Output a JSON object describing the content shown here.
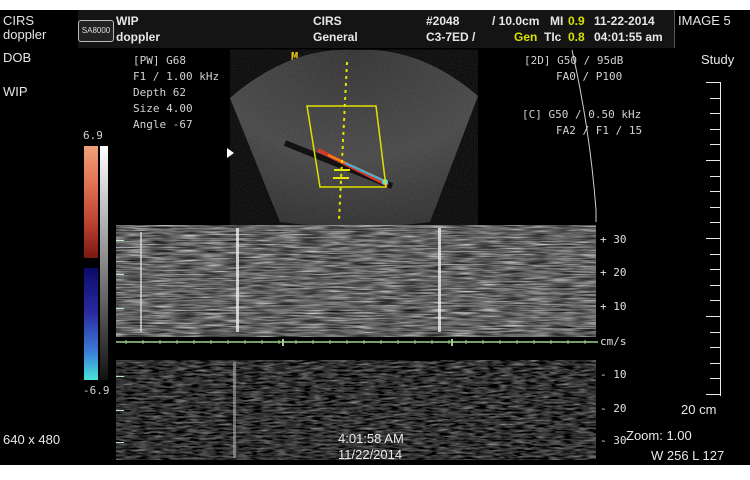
{
  "header": {
    "left_title": "CIRS",
    "left_sub": "doppler",
    "logo": "SA8000",
    "wip_title": "WIP",
    "wip_sub": "doppler",
    "center_title": "CIRS",
    "center_sub": "General",
    "probe_id": "#2048",
    "depth_cm": "/ 10.0cm",
    "mi_label": "MI",
    "mi_value": "0.9",
    "probe_model": "C3-7ED /",
    "gen_label": "Gen",
    "tic_label": "TIc",
    "tic_value": "0.8",
    "date": "11-22-2014",
    "time": "04:01:55 am",
    "image_label": "IMAGE 5"
  },
  "side_left": {
    "dob": "DOB",
    "wip": "WIP",
    "resolution": "640 x 480"
  },
  "side_right": {
    "study": "Study",
    "depth_scale": "20 cm",
    "zoom": "Zoom: 1.00",
    "window_level": "W 256 L 127"
  },
  "pw_params": {
    "line1": "[PW]  G68",
    "line2": "F1 / 1.00 kHz",
    "line3": "Depth  62",
    "line4": "Size   4.00",
    "line5": "Angle  -67"
  },
  "marker": "M",
  "params_2d": {
    "line1": "[2D] G50 / 95dB",
    "line2": "FA0 / P100"
  },
  "params_color": {
    "line1": "[C] G50 / 0.50 kHz",
    "line2": "FA2 / F1 / 15"
  },
  "color_scale": {
    "max": "6.9",
    "min": "-6.9"
  },
  "velocity_scale": {
    "p30": "+ 30",
    "p20": "+ 20",
    "p10": "+ 10",
    "unit": "cm/s",
    "m10": "- 10",
    "m20": "- 20",
    "m30": "- 30"
  },
  "footer": {
    "time": "4:01:58 AM",
    "date": "11/22/2014"
  },
  "colors": {
    "accent_green": "#9fd08f",
    "value_yellow": "#d8e000",
    "focus_yellow": "#e6e600",
    "color_box": "#e0e000"
  }
}
